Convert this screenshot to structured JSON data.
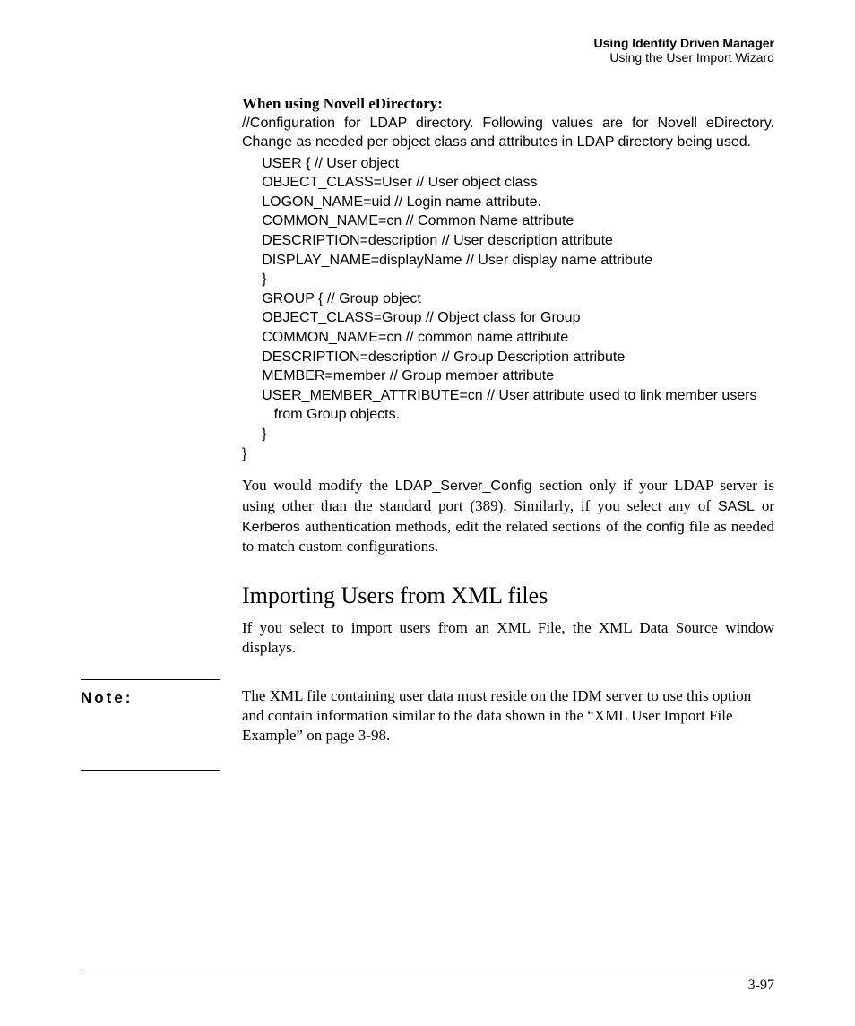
{
  "header": {
    "title": "Using Identity Driven Manager",
    "subtitle": "Using the User Import Wizard"
  },
  "edir": {
    "heading": "When using Novell eDirectory:",
    "intro": "//Configuration for LDAP directory. Following values are for Novell eDirectory. Change as needed per object class and attributes in LDAP directory being used.",
    "lines": [
      "     USER { // User object",
      "     OBJECT_CLASS=User // User object class",
      "     LOGON_NAME=uid // Login name attribute.",
      "     COMMON_NAME=cn // Common Name attribute",
      "     DESCRIPTION=description // User description attribute",
      "     DISPLAY_NAME=displayName // User display name attribute",
      "     }",
      "     GROUP { // Group object",
      "     OBJECT_CLASS=Group // Object class for Group",
      "     COMMON_NAME=cn // common name attribute",
      "     DESCRIPTION=description // Group Description attribute",
      "     MEMBER=member // Group member attribute",
      "     USER_MEMBER_ATTRIBUTE=cn // User attribute used to link member users",
      "        from Group objects.",
      "     }",
      "}"
    ]
  },
  "modify_para": {
    "p1": "You would modify the ",
    "c1": "LDAP_Server_Config",
    "p2": " section only if your LDAP server is using other than the standard port (389). Similarly, if you select any of ",
    "c2": "SASL",
    "p3": " or ",
    "c3": "Kerberos",
    "p4": " authentication methods, edit the related sections of the ",
    "c4": "config",
    "p5": " file as needed to match custom configurations."
  },
  "section_heading": "Importing Users from XML files",
  "xml_intro": "If you select to import users from an XML File, the XML Data Source window displays.",
  "note": {
    "label": "Note:",
    "body": "The XML file containing user data must reside on the IDM server to use this option and contain information similar to the data shown in the “XML User Import File Example” on page 3-98."
  },
  "page_number": "3-97"
}
